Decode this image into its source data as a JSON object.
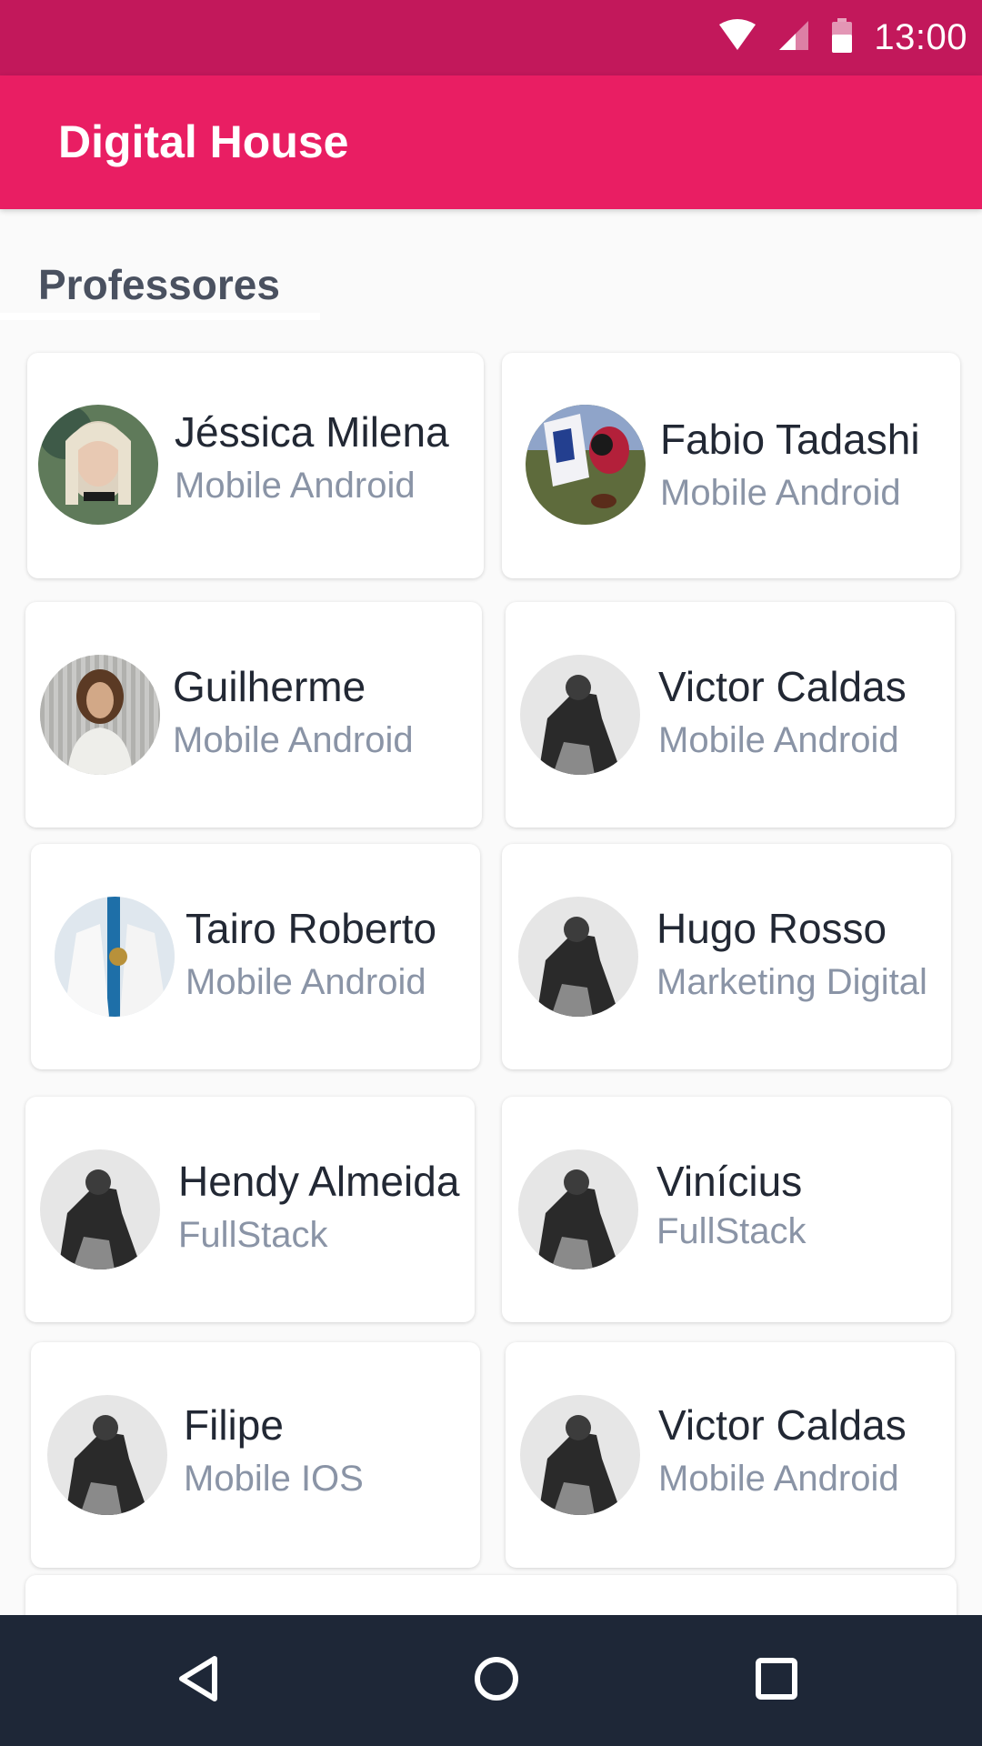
{
  "status_bar": {
    "time": "13:00",
    "icons": [
      "wifi-icon",
      "signal-icon",
      "battery-icon"
    ]
  },
  "app_bar": {
    "title": "Digital House",
    "color": "#e91e63",
    "status_color": "#c2185b"
  },
  "section": {
    "title": "Professores"
  },
  "teachers": [
    {
      "name": "Jéssica Milena",
      "role": "Mobile Android",
      "avatar": "photo-woman"
    },
    {
      "name": "Fabio Tadashi",
      "role": "Mobile Android",
      "avatar": "photo-football"
    },
    {
      "name": "Guilherme",
      "role": "Mobile Android",
      "avatar": "photo-man-curly"
    },
    {
      "name": "Victor Caldas",
      "role": "Mobile Android",
      "avatar": "photo-bw-default"
    },
    {
      "name": "Tairo Roberto",
      "role": "Mobile Android",
      "avatar": "photo-watch"
    },
    {
      "name": "Hugo Rosso",
      "role": "Marketing Digital",
      "avatar": "photo-bw-default"
    },
    {
      "name": "Hendy Almeida",
      "role": "FullStack",
      "avatar": "photo-bw-default"
    },
    {
      "name": "Vinícius",
      "role": "FullStack",
      "avatar": "photo-bw-default"
    },
    {
      "name": "Filipe",
      "role": "Mobile IOS",
      "avatar": "photo-bw-default"
    },
    {
      "name": "Victor Caldas",
      "role": "Mobile Android",
      "avatar": "photo-bw-default"
    }
  ],
  "nav_bar": {
    "buttons": [
      "back-icon",
      "home-icon",
      "recents-icon"
    ]
  }
}
